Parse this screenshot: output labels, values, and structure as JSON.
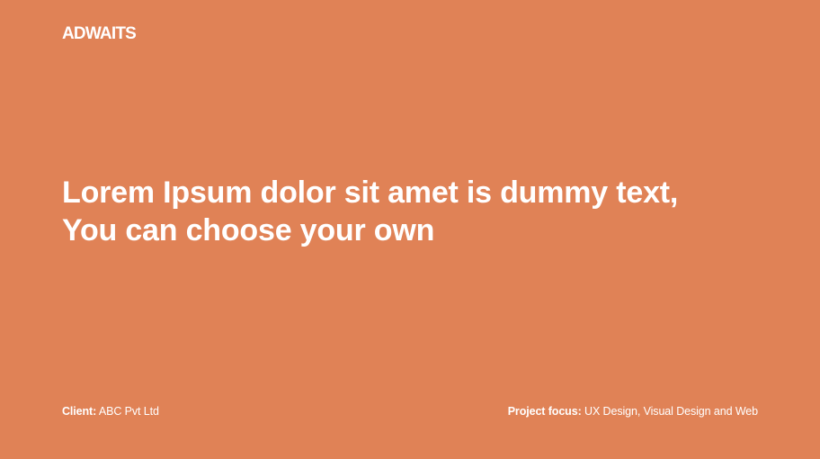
{
  "brand": {
    "logo_text": "ADWAITS"
  },
  "headline": {
    "line1": "Lorem Ipsum dolor sit amet is dummy text,",
    "line2": "You can choose your own"
  },
  "footer": {
    "client_label": "Client:",
    "client_value": "ABC Pvt Ltd",
    "focus_label": "Project focus:",
    "focus_value": "UX Design, Visual Design and Web"
  },
  "colors": {
    "background": "#e08256",
    "text": "#ffffff"
  }
}
